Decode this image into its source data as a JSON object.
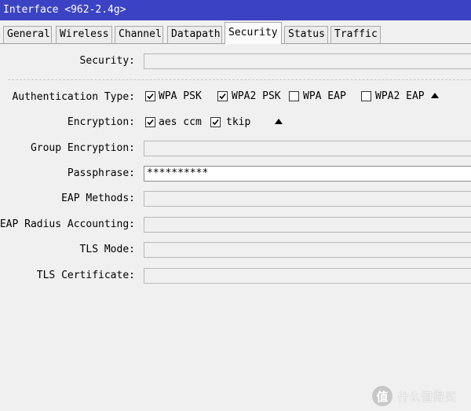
{
  "window": {
    "title": "Interface <962-2.4g>"
  },
  "tabs": [
    {
      "label": "General"
    },
    {
      "label": "Wireless"
    },
    {
      "label": "Channel"
    },
    {
      "label": "Datapath"
    },
    {
      "label": "Security"
    },
    {
      "label": "Status"
    },
    {
      "label": "Traffic"
    }
  ],
  "active_tab": "Security",
  "form": {
    "security": {
      "label": "Security:",
      "value": ""
    },
    "authentication_type": {
      "label": "Authentication Type:",
      "options": [
        {
          "label": "WPA PSK",
          "checked": true
        },
        {
          "label": "WPA2 PSK",
          "checked": true
        },
        {
          "label": "WPA EAP",
          "checked": false
        },
        {
          "label": "WPA2 EAP",
          "checked": false
        }
      ]
    },
    "encryption": {
      "label": "Encryption:",
      "options": [
        {
          "label": "aes ccm",
          "checked": true
        },
        {
          "label": "tkip",
          "checked": true
        }
      ]
    },
    "group_encryption": {
      "label": "Group Encryption:",
      "value": ""
    },
    "passphrase": {
      "label": "Passphrase:",
      "value": "**********"
    },
    "eap_methods": {
      "label": "EAP Methods:",
      "value": ""
    },
    "eap_radius_accounting": {
      "label": "EAP Radius Accounting:",
      "value": ""
    },
    "tls_mode": {
      "label": "TLS Mode:",
      "value": ""
    },
    "tls_certificate": {
      "label": "TLS Certificate:",
      "value": ""
    }
  },
  "icons": {
    "collapse": "triangle-up-icon",
    "check": "checkmark-icon"
  },
  "watermark": {
    "logo": "值",
    "text": "什么值得买"
  },
  "colors": {
    "titlebar": "#3b43c4",
    "field_bg": "#f0f0f0",
    "field_active_bg": "#ffffff"
  }
}
